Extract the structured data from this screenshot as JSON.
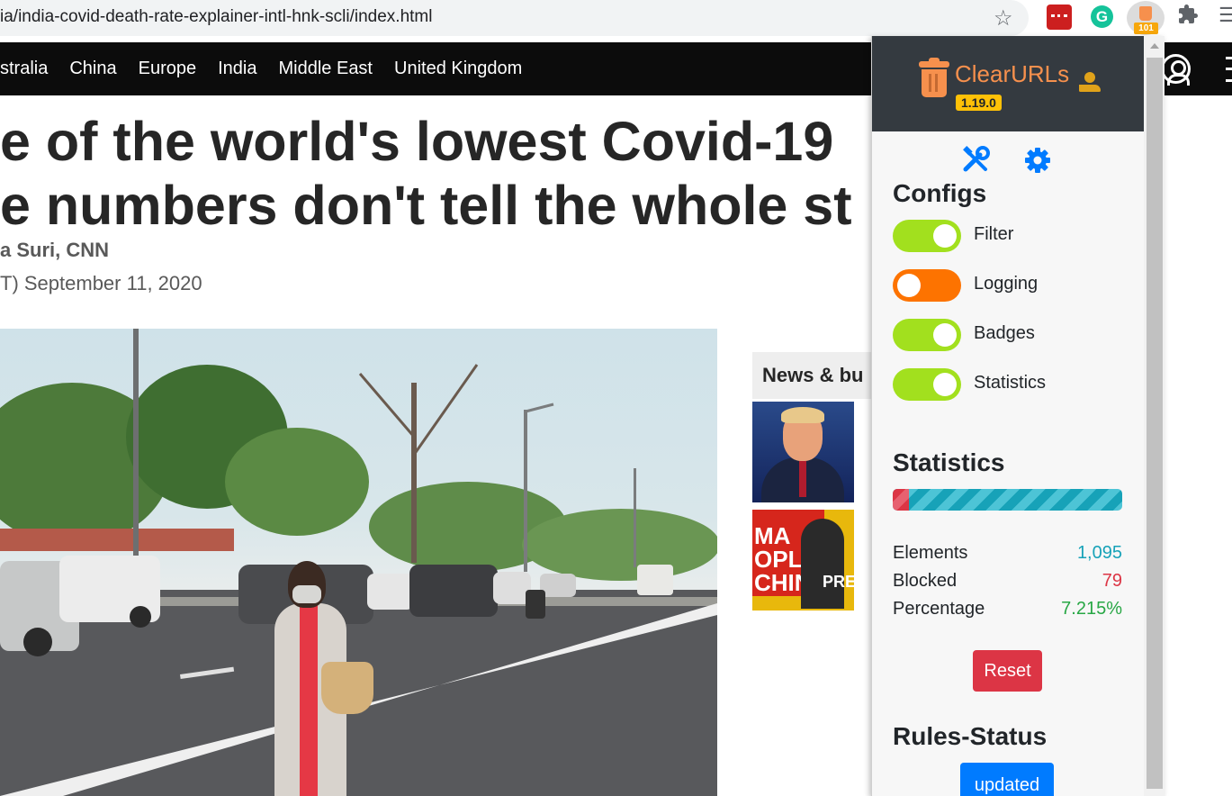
{
  "browser": {
    "url": "ia/india-covid-death-rate-explainer-intl-hnk-scli/index.html",
    "extension_badge": "101",
    "icons": [
      "star-icon",
      "extension-red-icon",
      "grammarly-icon",
      "clearurls-extension-icon",
      "puzzle-icon",
      "menu-icon"
    ]
  },
  "nav": {
    "links": [
      "stralia",
      "China",
      "Europe",
      "India",
      "Middle East",
      "United Kingdom"
    ]
  },
  "article": {
    "headline_line1": "e of the world's lowest Covid-19",
    "headline_line2": "e numbers don't tell the whole st",
    "byline": "a Suri, CNN",
    "dateline": "T) September 11, 2020"
  },
  "sidebar": {
    "news_title": "News & bu"
  },
  "popup": {
    "app_name": "ClearURLs",
    "version": "1.19.0",
    "configs_title": "Configs",
    "switches": [
      {
        "label": "Filter",
        "on": true
      },
      {
        "label": "Logging",
        "on": false
      },
      {
        "label": "Badges",
        "on": true
      },
      {
        "label": "Statistics",
        "on": true
      }
    ],
    "statistics_title": "Statistics",
    "progress_blocked_fraction": 0.07215,
    "stats": {
      "elements_label": "Elements",
      "elements_value": "1,095",
      "blocked_label": "Blocked",
      "blocked_value": "79",
      "percentage_label": "Percentage",
      "percentage_value": "7.215%"
    },
    "reset_label": "Reset",
    "rules_title": "Rules-Status",
    "rules_status": "updated",
    "colors": {
      "header": "#343a40",
      "accent": "#f6904d",
      "switch_on": "#a2e01e",
      "switch_off": "#fd7300",
      "elements": "#17a2b8",
      "blocked": "#dc3545",
      "percentage": "#28a745",
      "updated": "#007bff"
    }
  }
}
